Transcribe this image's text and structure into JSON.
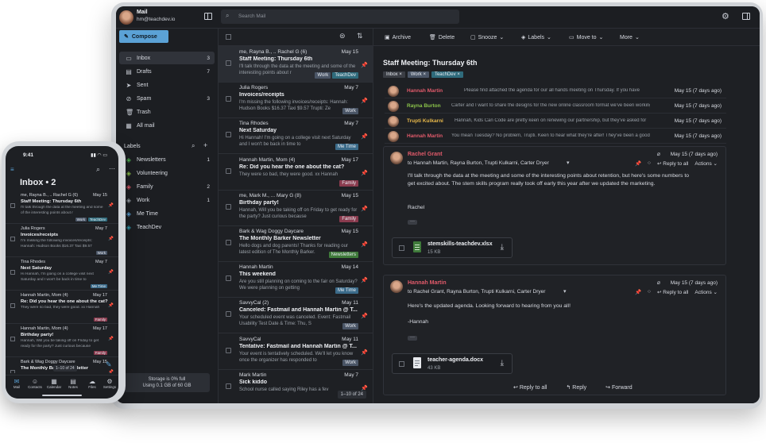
{
  "account": {
    "name": "Mail",
    "email": "hm@teachdev.io"
  },
  "search": {
    "placeholder": "Search Mail"
  },
  "compose_label": "Compose",
  "nav": [
    {
      "label": "Inbox",
      "count": "3",
      "icon": "inbox-icon"
    },
    {
      "label": "Drafts",
      "count": "7",
      "icon": "draft-icon"
    },
    {
      "label": "Sent",
      "count": "",
      "icon": "send-icon"
    },
    {
      "label": "Spam",
      "count": "3",
      "icon": "spam-icon"
    },
    {
      "label": "Trash",
      "count": "",
      "icon": "trash-icon"
    },
    {
      "label": "All mail",
      "count": "",
      "icon": "all-mail-icon"
    }
  ],
  "labels_heading": "Labels",
  "labels": [
    {
      "label": "Newsletters",
      "count": "1",
      "color": "#4caf50"
    },
    {
      "label": "Volunteering",
      "count": "",
      "color": "#8bc34a"
    },
    {
      "label": "Family",
      "count": "2",
      "color": "#e05a6a"
    },
    {
      "label": "Work",
      "count": "1",
      "color": "#9aa0a8"
    },
    {
      "label": "Me Time",
      "count": "",
      "color": "#5ba2d6"
    },
    {
      "label": "TeachDev",
      "count": "",
      "color": "#2f9cb0"
    }
  ],
  "storage": {
    "line1": "Storage is 0% full",
    "line2": "Using 0.1 GB of 60 GB"
  },
  "emails": [
    {
      "from": "me, Rayna B., .. Rachel G (6)",
      "date": "May 15",
      "subject": "Staff Meeting: Thursday 6th",
      "preview": "I'll talk through the data at the meeting and some of the interesting points about r",
      "tags": [
        "Work",
        "TeachDev"
      ],
      "pinned": true
    },
    {
      "from": "Julia Rogers",
      "date": "May 7",
      "subject": "Invoices/receipts",
      "preview": "I'm missing the following invoices/receipts: Hannah: Hudson Books $16.37 Taxi $9.57 Trupti: Ze",
      "tags": [
        "Work"
      ],
      "pinned": true
    },
    {
      "from": "Tina Rhodes",
      "date": "May 7",
      "subject": "Next Saturday",
      "preview": "Hi Hannah! I'm going on a college visit next Saturday and I won't be back in time to",
      "tags": [
        "Me Time"
      ],
      "pinned": true
    },
    {
      "from": "Hannah Martin, Mom (4)",
      "date": "May 17",
      "subject": "Re: Did you hear the one about the cat?",
      "preview": "They were so bad, they were good. xx Hannah",
      "tags": [
        "Family"
      ],
      "pinned": false
    },
    {
      "from": "me, Mark M., ... Mary G (8)",
      "date": "May 15",
      "subject": "Birthday party!",
      "preview": "Hannah, Will you be taking off on Friday to get ready for the party? Just curious because",
      "tags": [
        "Family"
      ],
      "pinned": false
    },
    {
      "from": "Bark & Wag Doggy Daycare",
      "date": "May 15",
      "subject": "The Monthly Barker Newsletter",
      "preview": "Hello dogs and dog parents! Thanks for reading our latest edition of The Monthly Barker.",
      "tags": [
        "Newsletters"
      ],
      "pinned": false
    },
    {
      "from": "Hannah Martin",
      "date": "May 14",
      "subject": "This weekend",
      "preview": "Are you still planning on coming to the fair on Saturday? We were planning on getting",
      "tags": [
        "Me Time"
      ],
      "pinned": false
    },
    {
      "from": "SavvyCal (2)",
      "date": "May 11",
      "subject": "Canceled: Fastmail and Hannah Martin @ T...",
      "preview": "Your scheduled event was canceled. Event: Fastmail Usability Test Date & Time: Thu, S",
      "tags": [
        "Work"
      ],
      "pinned": false
    },
    {
      "from": "SavvyCal",
      "date": "May 11",
      "subject": "Tentative: Fastmail and Hannah Martin @ T...",
      "preview": "Your event is tentatively scheduled. We'll let you know once the organizer has responded to",
      "tags": [
        "Work"
      ],
      "pinned": false
    },
    {
      "from": "Mark Martin",
      "date": "May 7",
      "subject": "Sick kiddo",
      "preview": "School nurse called saying Riley has a fev",
      "tags": [],
      "pinned": false
    }
  ],
  "pager": "1–10 of 24",
  "toolbar": {
    "archive": "Archive",
    "delete": "Delete",
    "snooze": "Snooze",
    "labels": "Labels",
    "move": "Move to",
    "more": "More"
  },
  "reader": {
    "title": "Staff Meeting: Thursday 6th",
    "tags": [
      "Inbox",
      "Work",
      "TeachDev"
    ],
    "thread": [
      {
        "name": "Hannah Martin",
        "color": "#e05a6a",
        "snippet": "Please find attached the agenda for our all hands meeting on Thursday. If you have",
        "date": "May 15 (7 days ago)"
      },
      {
        "name": "Rayna Burton",
        "color": "#8bc34a",
        "snippet": "Carter and I want to share the designs for the new online classroom format we've been working",
        "date": "May 15 (7 days ago)"
      },
      {
        "name": "Trupti Kulkarni",
        "color": "#e8b84a",
        "snippet": "Hannah, Kids Can Code are pretty keen on renewing our partnership, but they've asked for",
        "date": "May 15 (7 days ago)"
      },
      {
        "name": "Hannah Martin",
        "color": "#e05a6a",
        "snippet": "You mean Tuesday? No problem, Trupti. Keen to hear what they're after! They've been a good",
        "date": "May 15 (7 days ago)"
      }
    ],
    "msg1": {
      "name": "Rachel Grant",
      "to": "to Hannah Martin, Rayna Burton, Trupti Kulkarni, Carter Dryer",
      "date": "May 15 (7 days ago)",
      "reply_all": "Reply to all",
      "actions": "Actions",
      "body": "I'll talk through the data at the meeting and some of the interesting points about retention, but here's some numbers to get excited about. The stem skills program really took off early this year after we updated the marketing.",
      "sign": "Rachel",
      "attachment": {
        "name": "stemskills-teachdev.xlsx",
        "size": "15 KB"
      }
    },
    "msg2": {
      "name": "Hannah Martin",
      "to": "to Rachel Grant, Rayna Burton, Trupti Kulkarni, Carter Dryer",
      "date": "May 15 (7 days ago)",
      "reply_all": "Reply to all",
      "actions": "Actions",
      "body": "Here's the updated agenda. Looking forward to hearing from you all!",
      "sign": "-Hannah",
      "attachment": {
        "name": "teacher-agenda.docx",
        "size": "43 KB"
      }
    },
    "bottom": {
      "reply_all": "Reply to all",
      "reply": "Reply",
      "forward": "Forward"
    }
  },
  "phone": {
    "time": "9:41",
    "title": "Inbox • 2",
    "emails": [
      {
        "from": "me, Rayna B., .. Rachel G (6)",
        "date": "May 15",
        "subject": "Staff Meeting: Thursday 6th",
        "preview": "I'll talk through the data at the meeting and some of the interesting points about r",
        "tags": [
          "Work",
          "TeachDev"
        ],
        "pinned": true
      },
      {
        "from": "Julia Rogers",
        "date": "May 7",
        "subject": "Invoices/receipts",
        "preview": "I'm missing the following invoices/receipts: Hannah: Hudson Books $16.37 Taxi $9.57",
        "tags": [
          "Work"
        ],
        "pinned": true
      },
      {
        "from": "Tina Rhodes",
        "date": "May 7",
        "subject": "Next Saturday",
        "preview": "Hi Hannah, I'm going on a college visit next Saturday and I won't be back in time to",
        "tags": [
          "Me Time"
        ],
        "pinned": true
      },
      {
        "from": "Hannah Martin, Mom (4)",
        "date": "May 17",
        "subject": "Re: Did you hear the one about the cat?",
        "preview": "They were so bad, they were good. xx Hannah",
        "tags": [
          "Family"
        ],
        "pinned": false
      },
      {
        "from": "Hannah Martin, Mom (4)",
        "date": "May 17",
        "subject": "Birthday party!",
        "preview": "Hannah, Will you be taking off on Friday to get ready for the party? Just curious because",
        "tags": [
          "Family"
        ],
        "pinned": false
      },
      {
        "from": "Bark & Wag Doggy Daycare",
        "date": "May 15",
        "subject": "The Monthly Barker Newsletter",
        "preview": "",
        "tags": [],
        "pinned": false
      }
    ],
    "pager": "1–10 of 24",
    "tabs": [
      "Mail",
      "Contacts",
      "Calendar",
      "Notes",
      "Files",
      "Settings"
    ]
  }
}
